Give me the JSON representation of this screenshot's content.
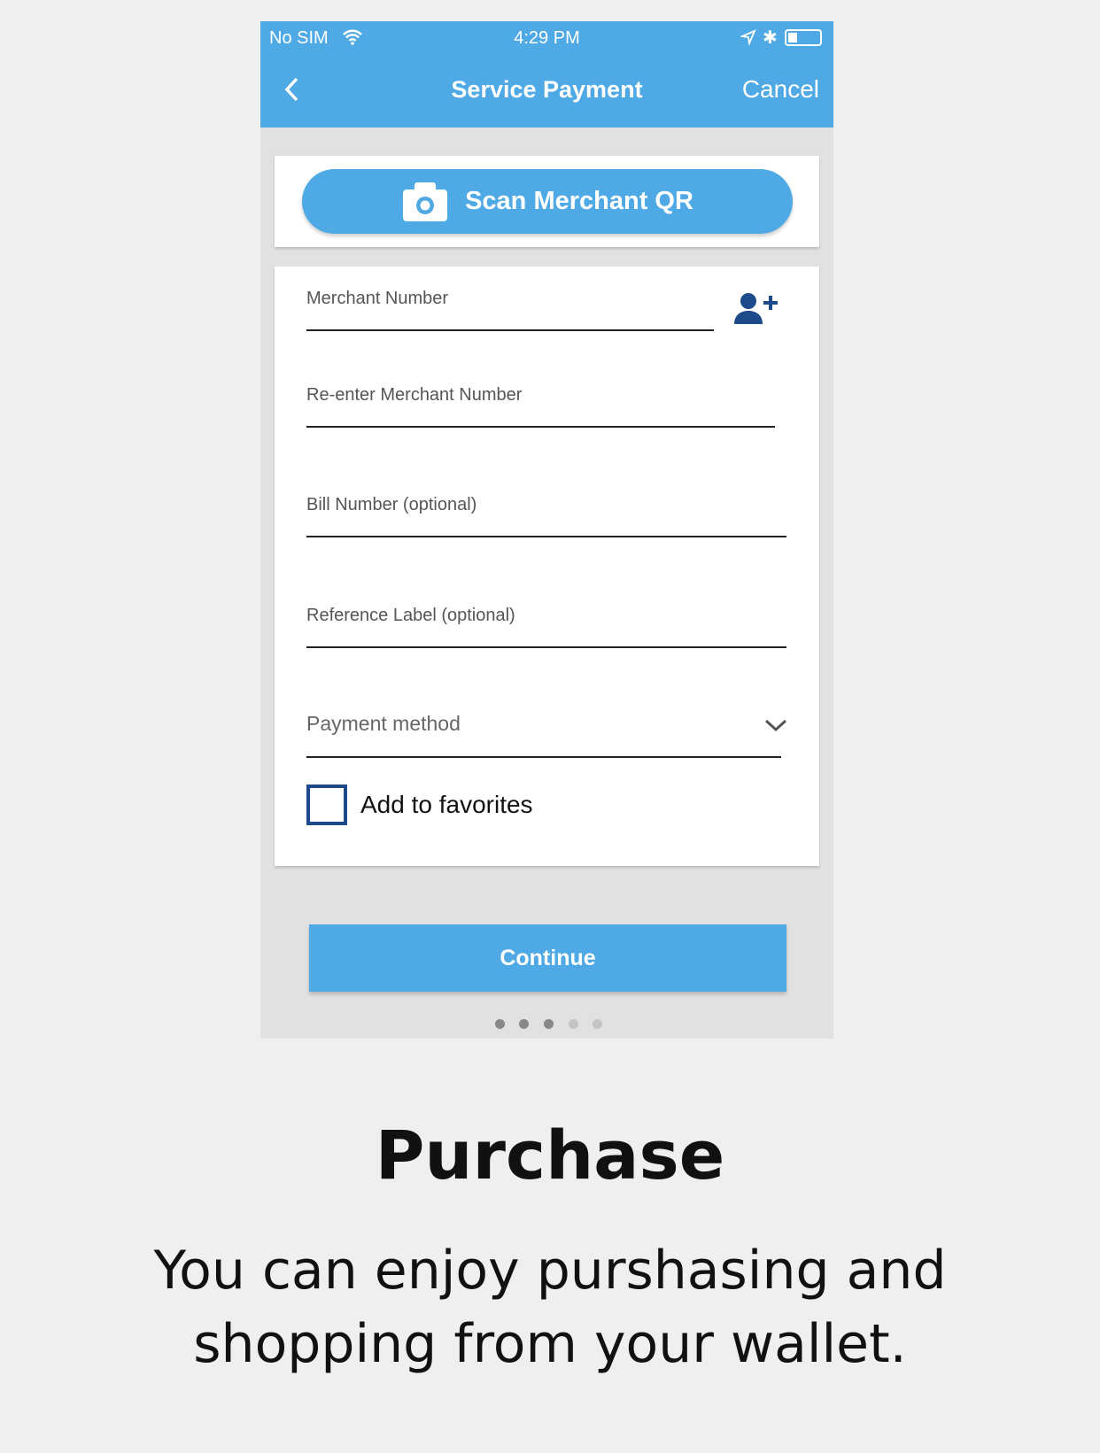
{
  "status_bar": {
    "carrier": "No SIM",
    "time": "4:29 PM"
  },
  "nav": {
    "title": "Service Payment",
    "cancel": "Cancel"
  },
  "scan_button": {
    "label": "Scan Merchant QR"
  },
  "form": {
    "merchant_number": "Merchant Number",
    "reenter_merchant_number": "Re-enter Merchant Number",
    "bill_number": "Bill Number (optional)",
    "reference_label": "Reference Label (optional)",
    "payment_method": "Payment method",
    "add_to_favorites": "Add to favorites",
    "add_to_favorites_checked": false
  },
  "continue_label": "Continue",
  "pager": {
    "total": 5,
    "active": 3
  },
  "caption": {
    "title": "Purchase",
    "line1": "You can enjoy purshasing and",
    "line2": "shopping from your wallet."
  },
  "colors": {
    "primary": "#4ea9e5",
    "icon_dark": "#1d4a8a"
  }
}
